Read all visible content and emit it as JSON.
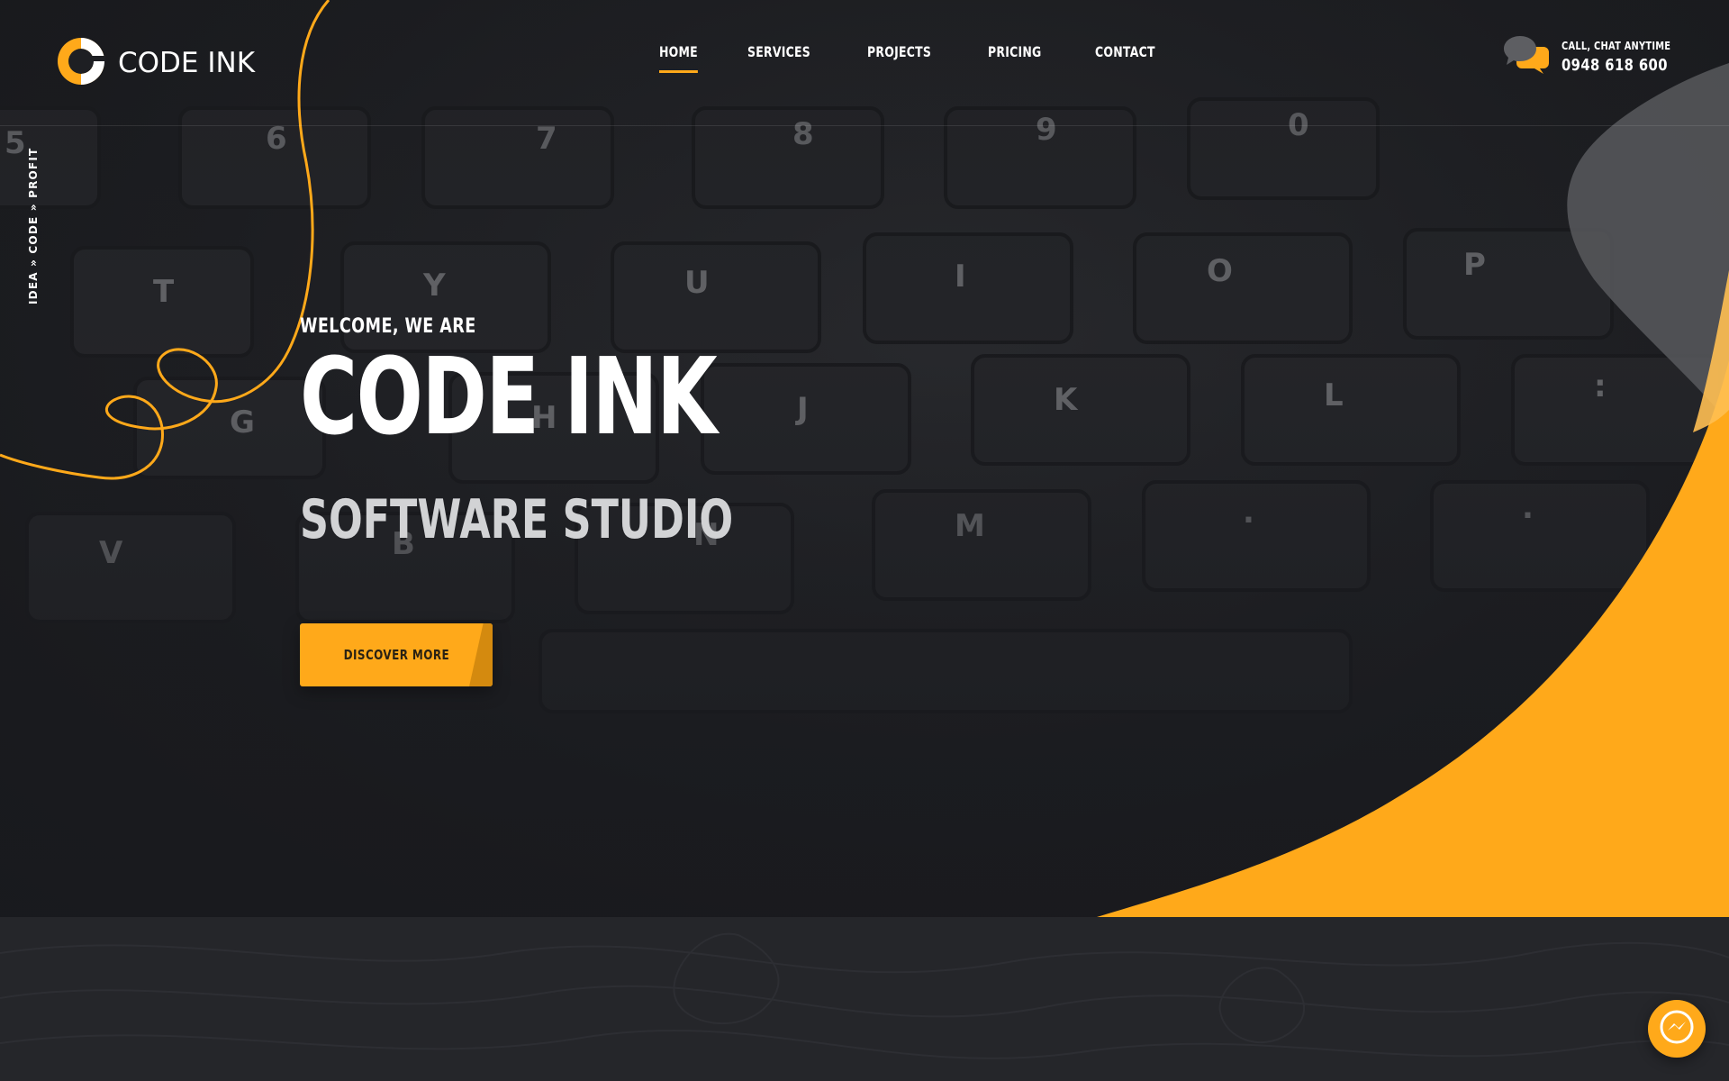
{
  "brand": {
    "name": "CODE INK",
    "logo_icon": "code-ink-logo-icon"
  },
  "nav": {
    "items": [
      {
        "label": "HOME",
        "active": true
      },
      {
        "label": "SERVICES",
        "active": false
      },
      {
        "label": "PROJECTS",
        "active": false
      },
      {
        "label": "PRICING",
        "active": false
      },
      {
        "label": "CONTACT",
        "active": false
      }
    ]
  },
  "contact": {
    "label": "CALL, CHAT ANYTIME",
    "phone": "0948 618 600",
    "icon": "chat-bubbles-icon"
  },
  "tagline": "IDEA » CODE » PROFIT",
  "hero": {
    "welcome": "WELCOME, WE ARE",
    "title": "CODE INK",
    "subtitle": "SOFTWARE STUDIO",
    "cta_label": "DISCOVER MORE"
  },
  "keyboard_keys": [
    "5",
    "6",
    "7",
    "8",
    "9",
    "0",
    "T",
    "Y",
    "U",
    "I",
    "O",
    "P",
    "G",
    "H",
    "J",
    "K",
    "L",
    ":",
    "V",
    "B",
    "N",
    "M",
    ".",
    "."
  ],
  "floating": {
    "messenger_icon": "messenger-icon"
  },
  "colors": {
    "accent": "#ffa91a",
    "accent_dark": "#d48a0f",
    "background": "#1e1f23",
    "lower_background": "#25262a",
    "text": "#ffffff"
  }
}
